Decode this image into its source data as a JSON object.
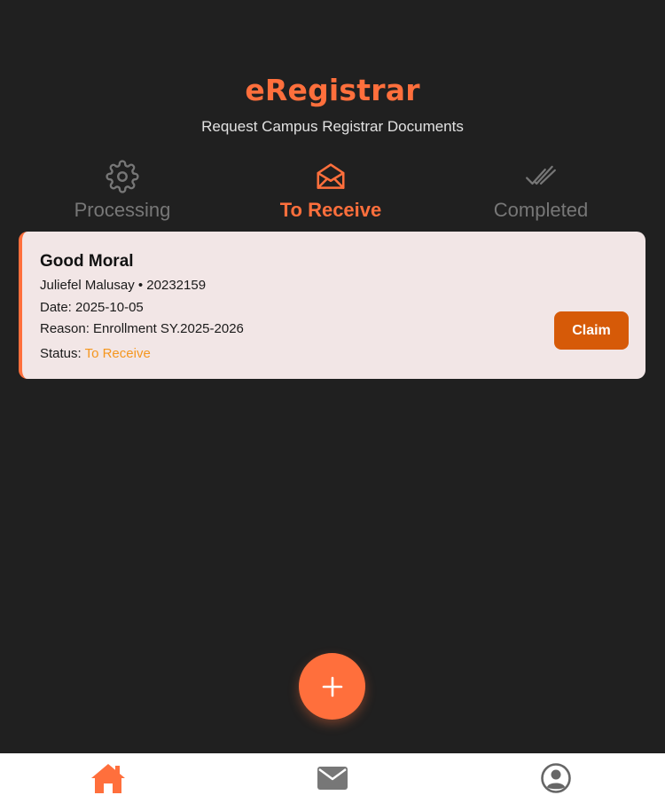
{
  "header": {
    "title": "eRegistrar",
    "subtitle": "Request Campus Registrar Documents"
  },
  "tabs": [
    {
      "label": "Processing",
      "icon": "gear-icon",
      "active": false
    },
    {
      "label": "To Receive",
      "icon": "open-envelope-icon",
      "active": true
    },
    {
      "label": "Completed",
      "icon": "double-check-icon",
      "active": false
    }
  ],
  "requests": [
    {
      "title": "Good Moral",
      "requester": "Juliefel Malusay • 20232159",
      "date": "Date: 2025-10-05",
      "reason": "Reason: Enrollment SY.2025-2026",
      "status_label": "Status: ",
      "status_value": "To Receive",
      "action_label": "Claim"
    }
  ],
  "fab": {
    "icon": "plus-icon"
  },
  "bottom_nav": [
    {
      "icon": "home-icon",
      "active": true
    },
    {
      "icon": "mail-icon",
      "active": false
    },
    {
      "icon": "profile-icon",
      "active": false
    }
  ],
  "colors": {
    "accent": "#ff6f3c",
    "background": "#202020",
    "card": "#f2e6e6",
    "claim_button": "#d65a08",
    "status": "#f5961e",
    "inactive": "#777777"
  }
}
